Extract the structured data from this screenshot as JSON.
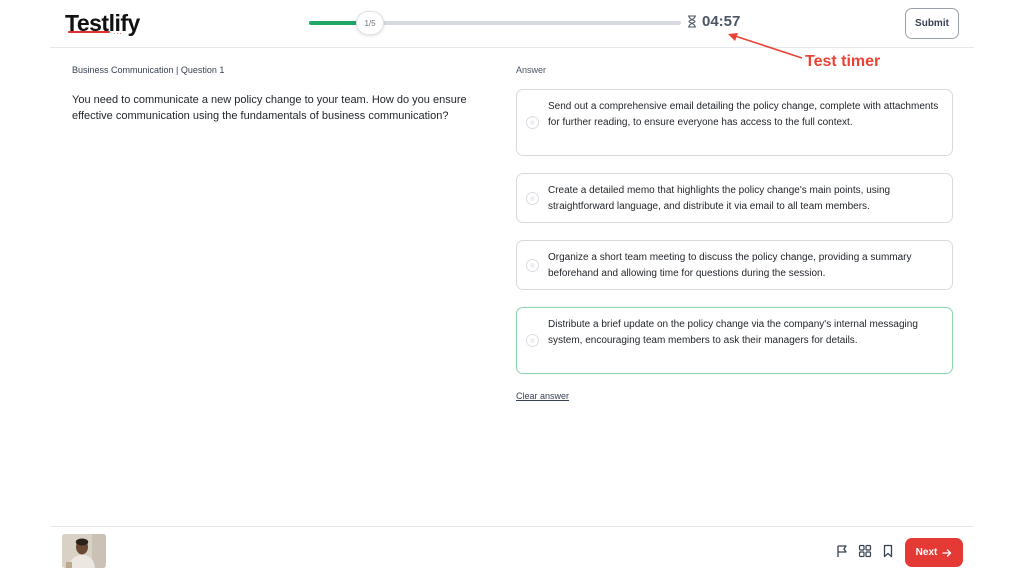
{
  "header": {
    "logo": "Testlify",
    "logo_dots": "...",
    "progress": {
      "label": "1/5",
      "current": 1,
      "total": 5,
      "fill_fraction": 0.13
    },
    "timer": "04:57",
    "submit_label": "Submit"
  },
  "annotation": {
    "label": "Test timer",
    "color": "#ea4335"
  },
  "question": {
    "meta": "Business Communication | Question 1",
    "text": "You need to communicate a new policy change to your team. How do you ensure effective communication using the fundamentals of business communication?"
  },
  "answer": {
    "label": "Answer",
    "options": [
      {
        "text": "Send out a comprehensive email detailing the policy change, complete with attachments for further reading, to ensure everyone has access to the full context."
      },
      {
        "text": "Create a detailed memo that highlights the policy change's main points, using straightforward language, and distribute it via email to all team members."
      },
      {
        "text": "Organize a short team meeting to discuss the policy change, providing a summary beforehand and allowing time for questions during the session."
      },
      {
        "text": "Distribute a brief update on the policy change via the company's internal messaging system, encouraging team members to ask their managers for details."
      }
    ],
    "clear_label": "Clear answer"
  },
  "footer": {
    "next_label": "Next"
  },
  "colors": {
    "accent_green": "#1ea765",
    "next_red": "#e53935"
  }
}
